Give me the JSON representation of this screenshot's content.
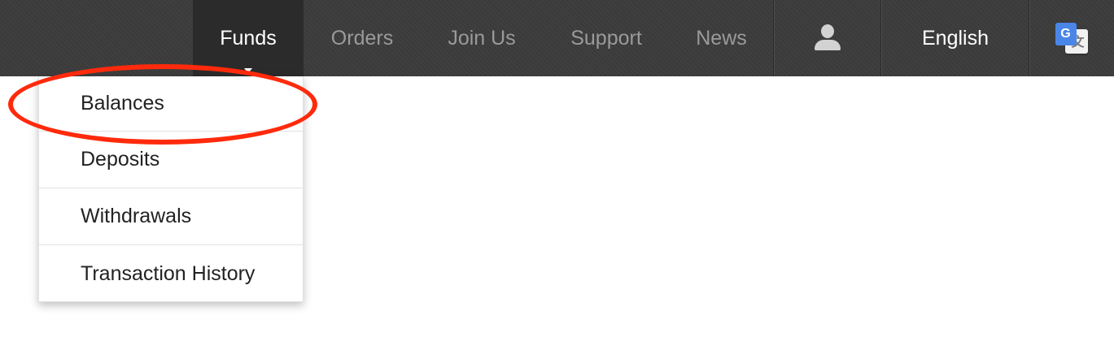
{
  "nav": {
    "items": [
      {
        "label": "Funds",
        "active": true
      },
      {
        "label": "Orders"
      },
      {
        "label": "Join Us"
      },
      {
        "label": "Support"
      },
      {
        "label": "News"
      }
    ],
    "user_icon": "user-icon",
    "language_label": "English",
    "translate_icon": "google-translate-icon",
    "translate_icon_letter": "G",
    "translate_icon_back_glyph": "文"
  },
  "dropdown": {
    "items": [
      {
        "label": "Balances",
        "highlighted": true
      },
      {
        "label": "Deposits"
      },
      {
        "label": "Withdrawals"
      },
      {
        "label": "Transaction History"
      }
    ]
  },
  "colors": {
    "navbar_bg": "#3c3c3c",
    "active_bg": "#2b2b2b",
    "inactive_text": "#9a9a9a",
    "highlight_ring": "#ff2a0c"
  }
}
